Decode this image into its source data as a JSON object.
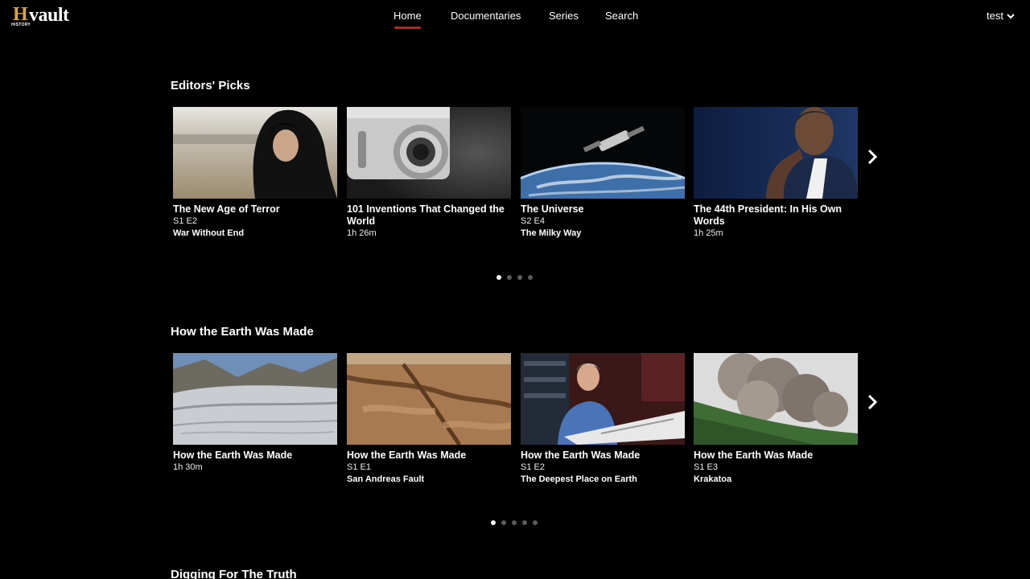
{
  "app": {
    "logo_mark": "H",
    "logo_sub": "HISTORY",
    "logo_name": "vault"
  },
  "nav": {
    "items": [
      {
        "label": "Home",
        "active": true
      },
      {
        "label": "Documentaries",
        "active": false
      },
      {
        "label": "Series",
        "active": false
      },
      {
        "label": "Search",
        "active": false
      }
    ]
  },
  "user": {
    "name": "test",
    "icon": "chevron-down-icon"
  },
  "rows": [
    {
      "title": "Editors' Picks",
      "next_icon": "chevron-right-icon",
      "dots_total": 4,
      "dots_active": 0,
      "cards": [
        {
          "title": "The New Age of Terror",
          "meta": "S1 E2",
          "subtitle": "War Without End"
        },
        {
          "title": "101 Inventions That Changed the World",
          "meta": "1h 26m",
          "subtitle": ""
        },
        {
          "title": "The Universe",
          "meta": "S2 E4",
          "subtitle": "The Milky Way"
        },
        {
          "title": "The 44th President: In His Own Words",
          "meta": "1h 25m",
          "subtitle": ""
        }
      ]
    },
    {
      "title": "How the Earth Was Made",
      "next_icon": "chevron-right-icon",
      "dots_total": 5,
      "dots_active": 0,
      "cards": [
        {
          "title": "How the Earth Was Made",
          "meta": "1h 30m",
          "subtitle": ""
        },
        {
          "title": "How the Earth Was Made",
          "meta": "S1 E1",
          "subtitle": "San Andreas Fault"
        },
        {
          "title": "How the Earth Was Made",
          "meta": "S1 E2",
          "subtitle": "The Deepest Place on Earth"
        },
        {
          "title": "How the Earth Was Made",
          "meta": "S1 E3",
          "subtitle": "Krakatoa"
        }
      ]
    },
    {
      "title": "Digging For The Truth"
    }
  ],
  "colors": {
    "background": "#000000",
    "accent": "#cc1b1b",
    "brand_gold": "#d9a443"
  }
}
